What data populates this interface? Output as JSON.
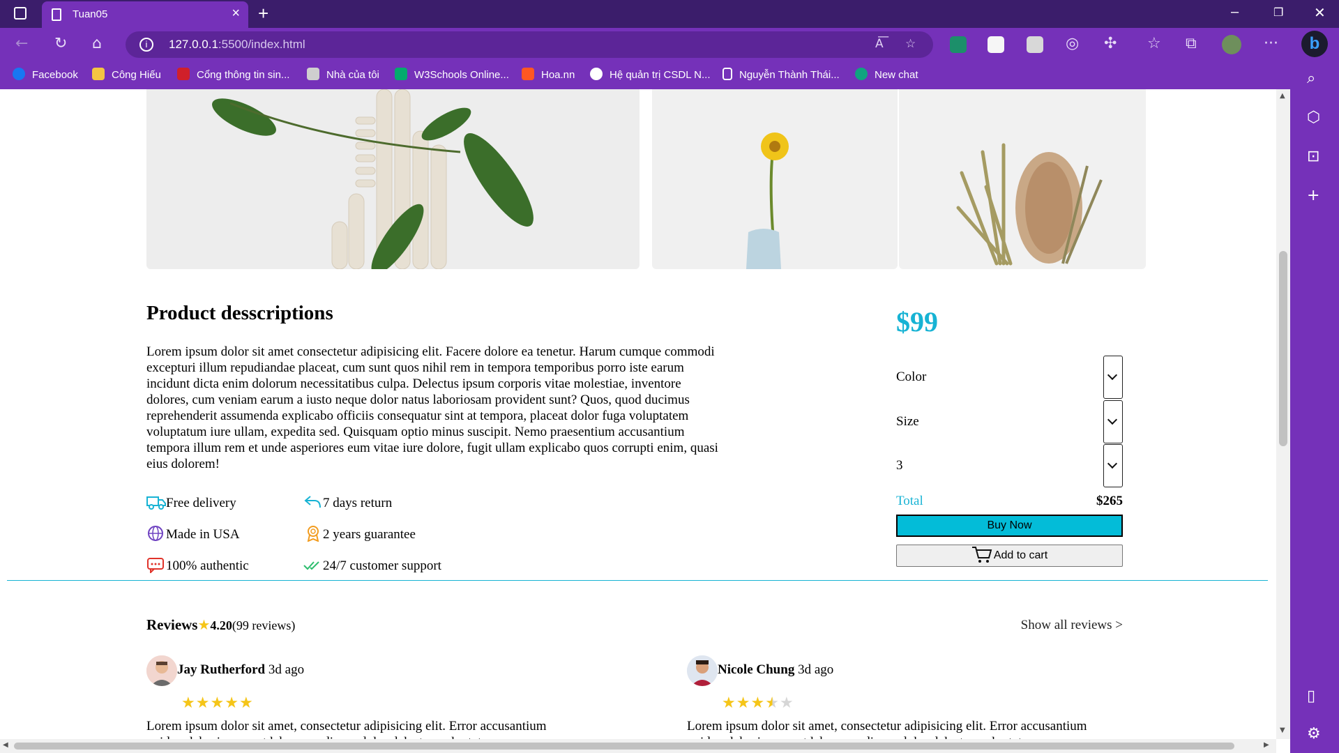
{
  "browser": {
    "tab_title": "Tuan05",
    "url_host": "127.0.0.1",
    "url_path": ":5500/index.html",
    "bookmarks": [
      {
        "label": "Facebook",
        "icon": "facebook-icon",
        "color": "#1877f2"
      },
      {
        "label": "Công Hiếu",
        "icon": "folder-icon",
        "color": "#f4c542"
      },
      {
        "label": "Cổng thông tin sin...",
        "icon": "portal-icon",
        "color": "#d0202a"
      },
      {
        "label": "Nhà của tôi",
        "icon": "home-site-icon",
        "color": "#cfcfcf"
      },
      {
        "label": "W3Schools Online...",
        "icon": "w3schools-icon",
        "color": "#04aa6d"
      },
      {
        "label": "Hoa.nn",
        "icon": "blogger-icon",
        "color": "#ff5722"
      },
      {
        "label": "Hệ quản trị CSDL N...",
        "icon": "wordpress-icon",
        "color": "#ffffff"
      },
      {
        "label": "Nguyễn Thành Thái...",
        "icon": "page-icon",
        "color": "#ffffff"
      },
      {
        "label": "New chat",
        "icon": "chatgpt-icon",
        "color": "#10a37f"
      }
    ]
  },
  "product": {
    "title": "Product desscriptions",
    "description": "Lorem ipsum dolor sit amet consectetur adipisicing elit. Facere dolore ea tenetur. Harum cumque commodi excepturi illum repudiandae placeat, cum sunt quos nihil rem in tempora temporibus porro iste earum incidunt dicta enim dolorum necessitatibus culpa. Delectus ipsum corporis vitae molestiae, inventore dolores, cum veniam earum a iusto neque dolor natus laboriosam provident sunt? Quos, quod ducimus reprehenderit assumenda explicabo officiis consequatur sint at tempora, placeat dolor fuga voluptatem voluptatum iure ullam, expedita sed. Quisquam optio minus suscipit. Nemo praesentium accusantium tempora illum rem et unde asperiores eum vitae iure dolore, fugit ullam explicabo quos corrupti enim, quasi eius dolorem!",
    "features": [
      {
        "label": "Free delivery",
        "icon": "truck-icon"
      },
      {
        "label": "7 days return",
        "icon": "return-arrow-icon"
      },
      {
        "label": "Made in USA",
        "icon": "globe-icon"
      },
      {
        "label": "2 years guarantee",
        "icon": "award-icon"
      },
      {
        "label": "100% authentic",
        "icon": "chat-bubble-icon"
      },
      {
        "label": "24/7 customer support",
        "icon": "double-check-icon"
      }
    ],
    "price": "$99",
    "options": {
      "color_label": "Color",
      "size_label": "Size",
      "quantity_value": "3"
    },
    "total_label": "Total",
    "total_value": "$265",
    "buy_now_label": "Buy Now",
    "add_to_cart_label": "Add to cart"
  },
  "reviews": {
    "title": "Reviews",
    "rating": "4.20",
    "count": "(99 reviews)",
    "show_all_label": "Show all reviews >",
    "items": [
      {
        "name": "Jay Rutherford",
        "when": "3d ago",
        "stars": 5,
        "text": "Lorem ipsum dolor sit amet, consectetur adipisicing elit. Error accusantium quidem laboriosam est labore modi non dolor delectus voluptates"
      },
      {
        "name": "Nicole Chung",
        "when": "3d ago",
        "stars": 3.5,
        "text": "Lorem ipsum dolor sit amet, consectetur adipisicing elit. Error accusantium quidem laboriosam est labore modi non dolor delectus voluptates"
      }
    ]
  },
  "colors": {
    "accent": "#17b3d4",
    "buy_button": "#03bcd8",
    "browser_purple": "#7531b9",
    "star": "#f5c518"
  }
}
